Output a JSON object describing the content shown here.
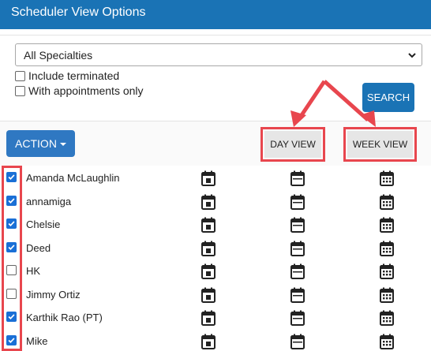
{
  "window": {
    "title": "Scheduler View Options"
  },
  "filters": {
    "specialty_value": "All Specialties",
    "include_terminated": {
      "label": "Include terminated",
      "checked": false
    },
    "with_appointments_only": {
      "label": "With appointments only",
      "checked": false
    },
    "search_label": "SEARCH"
  },
  "toolbar": {
    "action_label": "ACTION",
    "day_view_label": "DAY VIEW",
    "week_view_label": "WEEK VIEW"
  },
  "providers": [
    {
      "name": "Amanda McLaughlin",
      "checked": true
    },
    {
      "name": "annamiga",
      "checked": true
    },
    {
      "name": "Chelsie",
      "checked": true
    },
    {
      "name": "Deed",
      "checked": true
    },
    {
      "name": "HK",
      "checked": false
    },
    {
      "name": "Jimmy Ortiz",
      "checked": false
    },
    {
      "name": "Karthik Rao (PT)",
      "checked": true
    },
    {
      "name": "Mike",
      "checked": true
    }
  ],
  "colors": {
    "brand": "#1a73b5",
    "highlight": "#e8464e",
    "checkbox": "#1a6fd6"
  },
  "icons": {
    "day_schedule": "calendar-day-icon",
    "day_view": "calendar-blank-icon",
    "week_view": "calendar-grid-icon"
  }
}
